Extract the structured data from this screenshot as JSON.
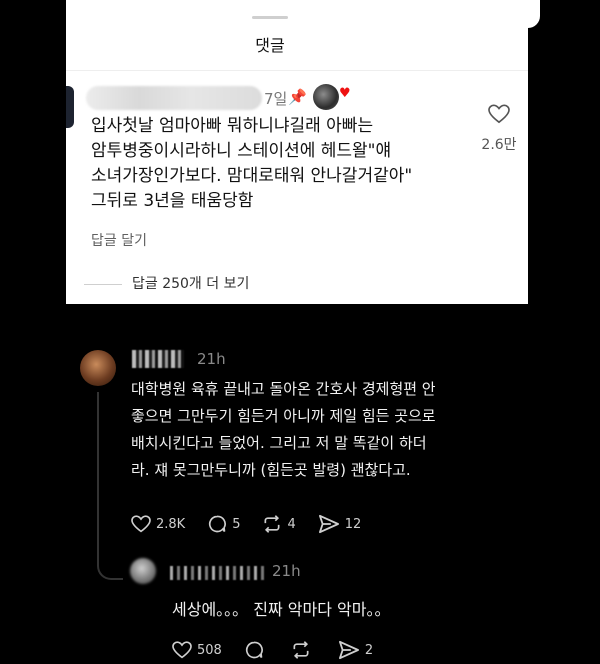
{
  "sheet": {
    "title": "댓글",
    "comment": {
      "time_ago": "7일",
      "lines": [
        "입사첫날 엄마아빠 뭐하니냐길래 아빠는",
        "암투병중이시라하니 스테이션에 헤드왈\"얘",
        "소녀가장인가보다. 맘대로태워 안나갈거같아\"",
        "그뒤로 3년을 태움당함"
      ],
      "like_count": "2.6만",
      "reply_label": "답글 달기"
    },
    "more_replies": "답글 250개 더 보기"
  },
  "thread": {
    "post": {
      "time": "21h",
      "lines": [
        "대학병원 육휴 끝내고 돌아온 간호사 경제형편 안",
        "좋으면 그만두기 힘든거 아니까 제일 힘든 곳으로",
        "배치시킨다고 들었어. 그리고 저 말 똑같이 하더",
        "라. 쟤 못그만두니까 (힘든곳 발령) 괜찮다고."
      ],
      "likes": "2.8K",
      "comments": "5",
      "reposts": "4",
      "shares": "12"
    },
    "reply": {
      "time": "21h",
      "text": "세상에。。。 진짜 악마다 악마。。",
      "likes": "508",
      "comments": "",
      "reposts": "",
      "shares": "2"
    }
  },
  "colors": {
    "sheet_bg": "#ffffff",
    "dark_bg": "#000000",
    "pin_badge": "#e11111"
  },
  "icons": [
    "pin-icon",
    "heart-icon",
    "comment-icon",
    "repost-icon",
    "share-icon"
  ]
}
